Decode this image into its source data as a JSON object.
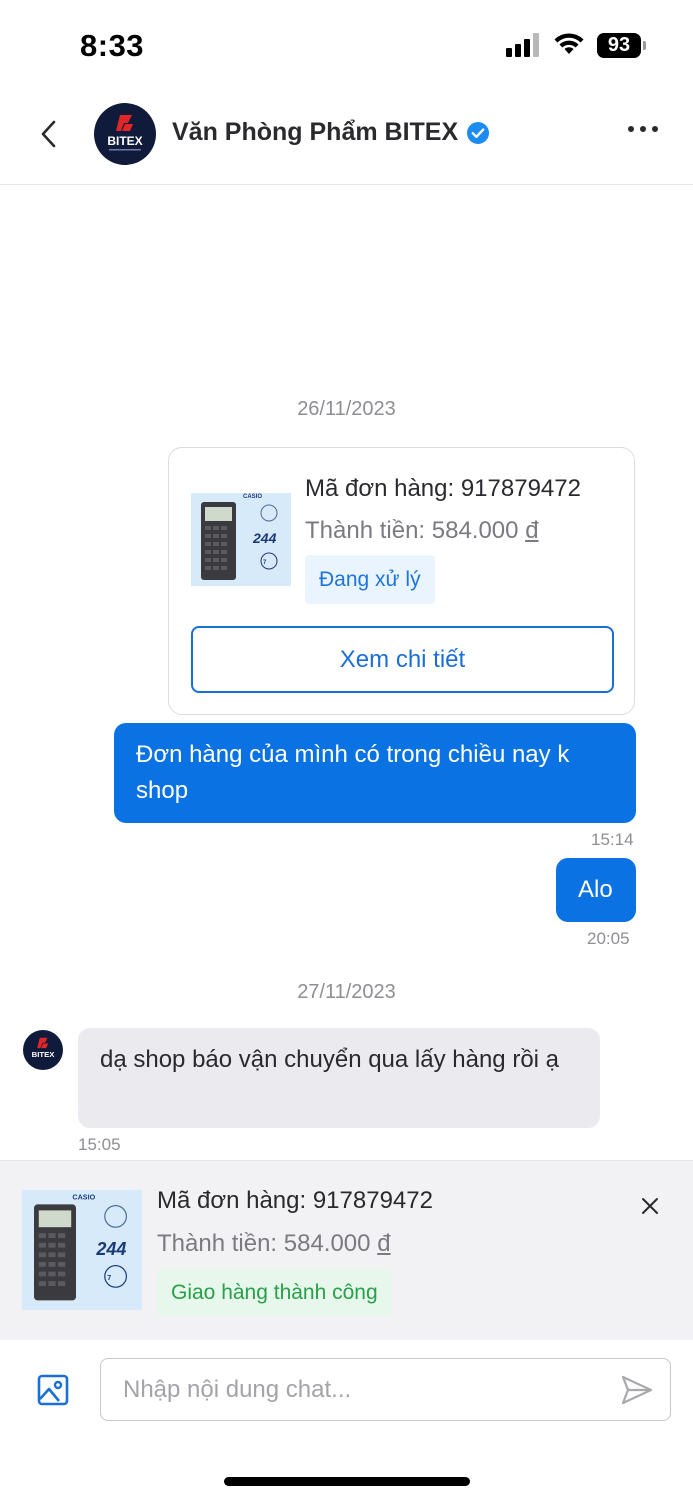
{
  "status_bar": {
    "time": "8:33",
    "battery": "93"
  },
  "header": {
    "shop_name": "Văn Phòng Phẩm BITEX",
    "avatar_text": "BITEX",
    "verified": true
  },
  "chat": {
    "date_1": "26/11/2023",
    "order_card": {
      "product_brand": "CASIO",
      "code_label": "Mã đơn hàng: 917879472",
      "total_label": "Thành tiền: 584.000",
      "currency": "đ",
      "status": "Đang xử lý",
      "detail_button": "Xem chi tiết"
    },
    "messages_day1": [
      {
        "direction": "out",
        "text": "Đơn hàng của mình có trong chiều nay k shop",
        "time": "15:14"
      },
      {
        "direction": "out",
        "text": "Alo",
        "time": "20:05"
      }
    ],
    "date_2": "27/11/2023",
    "messages_day2": [
      {
        "direction": "in",
        "text": "dạ shop báo vận chuyển qua lấy hàng rồi ạ",
        "time": "15:05"
      }
    ]
  },
  "pinned_order": {
    "product_brand": "CASIO",
    "code_label": "Mã đơn hàng: 917879472",
    "total_label": "Thành tiền: 584.000",
    "currency": "đ",
    "status": "Giao hàng thành công"
  },
  "input": {
    "placeholder": "Nhập nội dung chat..."
  },
  "colors": {
    "accent": "#0a72e2",
    "success": "#27a148",
    "verified": "#1d8cf0"
  }
}
